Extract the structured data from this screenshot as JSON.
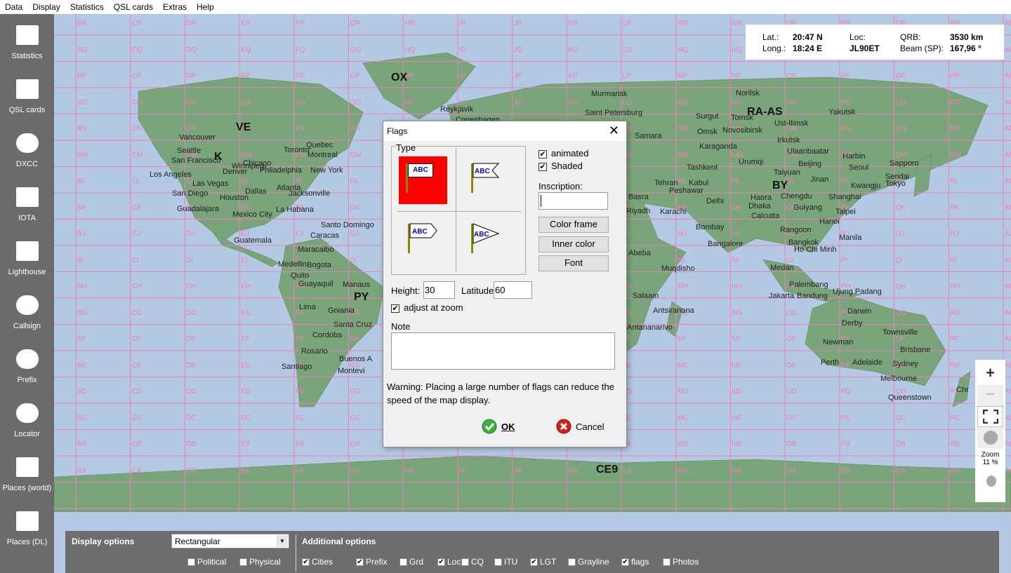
{
  "menu": [
    "Data",
    "Display",
    "Statistics",
    "QSL cards",
    "Extras",
    "Help"
  ],
  "sidebar": [
    {
      "label": "Statistics",
      "icon": "statistics-chart-icon"
    },
    {
      "label": "QSL cards",
      "icon": "qsl-card-icon"
    },
    {
      "label": "DXCC",
      "icon": "globe-icon"
    },
    {
      "label": "IOTA",
      "icon": "iota-palm-icon"
    },
    {
      "label": "Lighthouse",
      "icon": "lighthouse-icon"
    },
    {
      "label": "Callsign",
      "icon": "callsign-search-icon"
    },
    {
      "label": "Prefix",
      "icon": "prefix-search-icon"
    },
    {
      "label": "Locator",
      "icon": "locator-globe-icon"
    },
    {
      "label": "Places (world)",
      "icon": "world-map-icon"
    },
    {
      "label": "Places (DL)",
      "icon": "germany-map-icon"
    }
  ],
  "info": {
    "lat_label": "Lat.:",
    "lat": "20:47 N",
    "long_label": "Long.:",
    "long": "18:24 E",
    "loc_label": "Loc:",
    "loc": "JL90ET",
    "qrb_label": "QRB:",
    "qrb": "3530 km",
    "beam_label": "Beam (SP):",
    "beam": "167,96 °"
  },
  "map": {
    "grid_columns": [
      "B",
      "C",
      "D",
      "E",
      "F",
      "G",
      "H",
      "I",
      "J",
      "K",
      "L",
      "M",
      "N",
      "O",
      "P",
      "Q",
      "R",
      "A"
    ],
    "grid_rows": [
      "R",
      "Q",
      "P",
      "O",
      "N",
      "M",
      "L",
      "K",
      "J",
      "I",
      "H",
      "G",
      "F",
      "E",
      "D",
      "C",
      "B",
      "A"
    ],
    "prefixes": [
      "OX",
      "VE",
      "K",
      "RA-AS",
      "BY",
      "PY",
      "CE9"
    ],
    "cities": [
      "Reykjavik",
      "Murmansk",
      "Norilsk",
      "Saint Petersburg",
      "Surgut",
      "Tomsk",
      "Yakutsk",
      "Copenhagen",
      "Samara",
      "Omsk",
      "Novosibirsk",
      "Ust-Ilimsk",
      "Irkutsk",
      "Vancouver",
      "Seattle",
      "San Francisco",
      "Winnipeg",
      "Toronto",
      "Quebec",
      "Montreal",
      "Karaganda",
      "Ulaanbaatar",
      "Harbin",
      "Urumqi",
      "Beijing",
      "Seoul",
      "Sapporo",
      "Los Angeles",
      "Denver",
      "Chicago",
      "Philadelphia",
      "New York",
      "Tashkent",
      "Taiyuan",
      "Sendai",
      "Las Vegas",
      "Tehran",
      "Kabul",
      "Peshawar",
      "Jinan",
      "Kwangju",
      "Tokyo",
      "San Diego",
      "Dallas",
      "Atlanta",
      "Jacksonville",
      "Basra",
      "Delhi",
      "Haora",
      "Chengdu",
      "Shanghai",
      "Guadalajara",
      "Houston",
      "Mexico City",
      "La Habana",
      "Riyadh",
      "Karachi",
      "Dhaka",
      "Guiyang",
      "Taipei",
      "Calcutta",
      "Santo Domingo",
      "Bombay",
      "Rangoon",
      "Hanoi",
      "Caracas",
      "Guatemala",
      "Bangkok",
      "Manila",
      "Maracaibo",
      "Abeba",
      "Bangalore",
      "Ho Chi Minh",
      "Medellin",
      "Bogota",
      "Muqdisho",
      "Medan",
      "Quito",
      "Guayaquil",
      "Manaus",
      "Palembang",
      "Ujung Padang",
      "Lima",
      "Goiania",
      "Salaam",
      "Jakarta",
      "Bandung",
      "Darwin",
      "Antsiranana",
      "Santa Cruz",
      "Antananarivo",
      "Derby",
      "Townsville",
      "Cordoba",
      "Newman",
      "Brisbane",
      "Rosario",
      "Perth",
      "Adelaide",
      "Sydney",
      "Santiago",
      "Buenos A",
      "Montevi",
      "Melbourne",
      "Queenstown",
      "Chr"
    ]
  },
  "zoom": {
    "label": "Zoom",
    "value": "11 %"
  },
  "bottom": {
    "display_options": "Display options",
    "projection": "Rectangular",
    "political": "Political",
    "physical": "Physical",
    "additional_options": "Additional options",
    "options": [
      {
        "label": "Cities",
        "checked": true
      },
      {
        "label": "Prefix",
        "checked": true
      },
      {
        "label": "Grd",
        "checked": false
      },
      {
        "label": "Loc",
        "checked": true
      },
      {
        "label": "CQ",
        "checked": false
      },
      {
        "label": "ITU",
        "checked": false
      },
      {
        "label": "LGT",
        "checked": true
      },
      {
        "label": "Grayline",
        "checked": false
      },
      {
        "label": "flags",
        "checked": true
      },
      {
        "label": "Photos",
        "checked": false
      }
    ],
    "political_checked": false,
    "physical_checked": false
  },
  "dialog": {
    "title": "Flags",
    "type_label": "Type",
    "flag_text": "ABC",
    "animated": "animated",
    "shaded": "Shaded",
    "inscription_label": "Inscription:",
    "inscription_value": "",
    "color_frame": "Color frame",
    "inner_color": "Inner color",
    "font": "Font",
    "height_label": "Height:",
    "height_value": "30",
    "latitude_label": "Latitude",
    "latitude_value": "60",
    "adjust": "adjust at zoom",
    "note_label": "Note",
    "note_value": "",
    "warning": "Warning: Placing a large number of flags can reduce the speed of the map display.",
    "ok": "OK",
    "cancel": "Cancel",
    "selected_color": "#ff0000"
  }
}
